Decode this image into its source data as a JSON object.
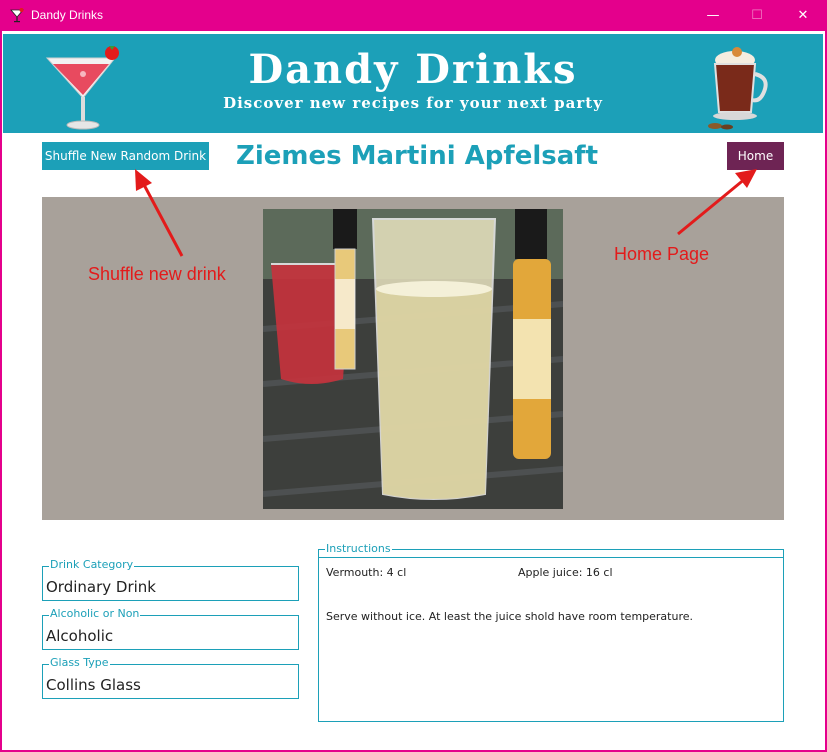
{
  "window": {
    "title": "Dandy Drinks",
    "minimize_glyph": "—",
    "maximize_glyph": "☐",
    "close_glyph": "✕",
    "accent_color": "#e4008c"
  },
  "banner": {
    "title": "Dandy Drinks",
    "subtitle": "Discover new recipes for your next party",
    "background_color": "#1ca0b8",
    "left_icon": "cocktail-glass-icon",
    "right_icon": "hot-chocolate-mug-icon"
  },
  "toolbar": {
    "shuffle_label": "Shuffle New Random Drink",
    "home_label": "Home"
  },
  "drink": {
    "name": "Ziemes Martini Apfelsaft",
    "category_label": "Drink Category",
    "category": "Ordinary Drink",
    "alcoholic_label": "Alcoholic or Non",
    "alcoholic": "Alcoholic",
    "glass_label": "Glass Type",
    "glass": "Collins Glass"
  },
  "instructions": {
    "label": "Instructions",
    "ingredients": [
      "Vermouth: 4 cl",
      "Apple juice: 16 cl"
    ],
    "text": "Serve without ice. At least the juice shold have room temperature."
  },
  "annotations": {
    "shuffle": "Shuffle new drink",
    "home": "Home Page",
    "color": "#e31b1b"
  }
}
